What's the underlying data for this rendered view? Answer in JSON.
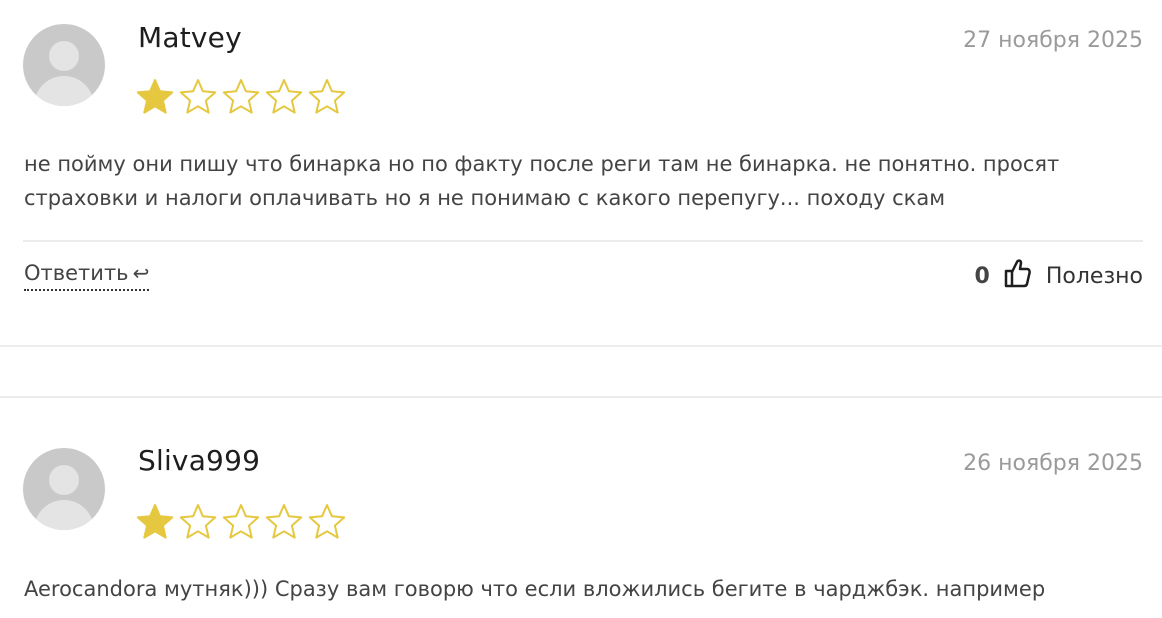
{
  "reviews": [
    {
      "author": "Matvey",
      "date": "27 ноября 2025",
      "rating": 1,
      "rating_max": 5,
      "text": "не пойму они пишу что бинарка но по факту после реги там не бинарка. не понятно. просят страховки и налоги оплачивать но я не понимаю с какого перепугу... походу скам",
      "reply_label": "Ответить",
      "useful_count": "0",
      "useful_label": "Полезно"
    },
    {
      "author": "Sliva999",
      "date": "26 ноября 2025",
      "rating": 1,
      "rating_max": 5,
      "text": "Aerocandora мутняк))) Сразу вам говорю что если вложились бегите в чарджбэк. например"
    }
  ],
  "colors": {
    "star_filled": "#e5c840",
    "star_outline": "#e5c840",
    "divider": "#ececec"
  },
  "icons": {
    "reply": "reply-arrow-icon",
    "thumb": "thumbs-up-icon"
  }
}
